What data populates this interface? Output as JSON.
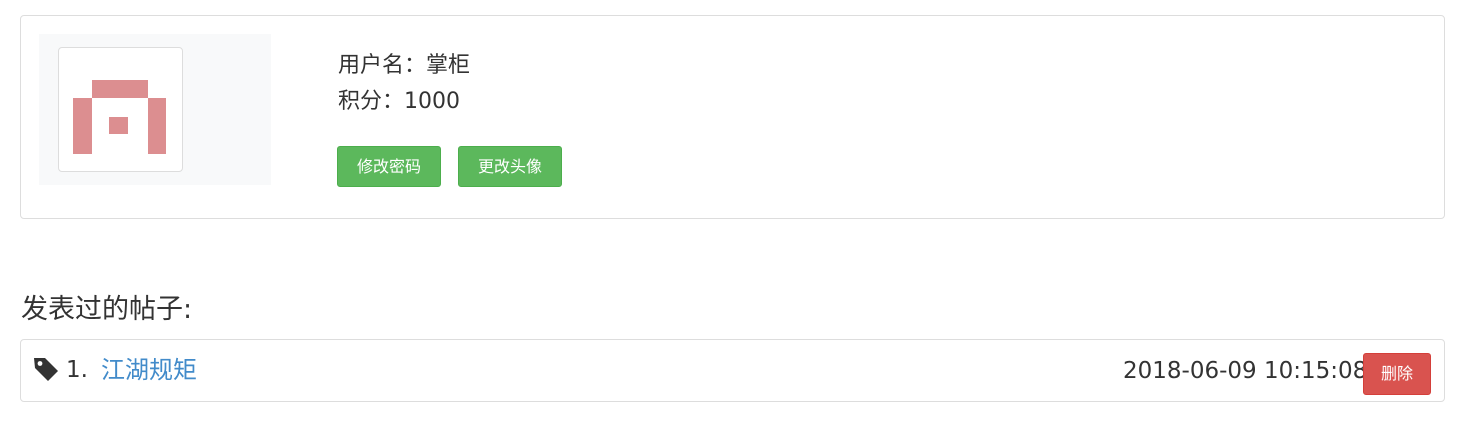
{
  "profile": {
    "avatar_icon": "identicon-avatar",
    "avatar_color": "#dc8e90",
    "username_label": "用户名：",
    "username": "掌柜",
    "points_label": "积分：",
    "points": "1000",
    "change_password_label": "修改密码",
    "change_avatar_label": "更改头像"
  },
  "posts_section": {
    "title": "发表过的帖子:",
    "items": [
      {
        "icon": "tag-icon",
        "index": "1.",
        "title": "江湖规矩",
        "time": "2018-06-09 10:15:08",
        "delete_label": "删除"
      }
    ]
  },
  "colors": {
    "success": "#5cb85c",
    "danger": "#d9534f",
    "link": "#428bca"
  }
}
